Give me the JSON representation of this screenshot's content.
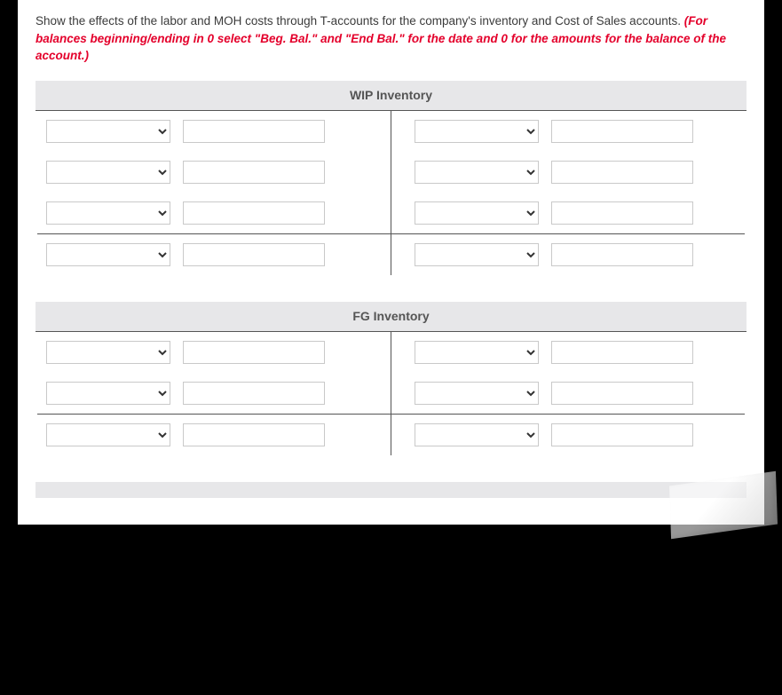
{
  "instructions": {
    "main": "Show the effects of the labor and MOH costs through T-accounts for the company's inventory and Cost of Sales accounts.",
    "note": " (For balances beginning/ending in 0 select \"Beg. Bal.\" and \"End Bal.\" for the date and 0 for the amounts for the balance of the account.)"
  },
  "accounts": {
    "wip": {
      "title": "WIP Inventory",
      "rows": [
        {
          "left": {
            "date": "",
            "amount": ""
          },
          "right": {
            "date": "",
            "amount": ""
          }
        },
        {
          "left": {
            "date": "",
            "amount": ""
          },
          "right": {
            "date": "",
            "amount": ""
          }
        },
        {
          "left": {
            "date": "",
            "amount": ""
          },
          "right": {
            "date": "",
            "amount": ""
          }
        }
      ],
      "balance": {
        "left": {
          "date": "",
          "amount": ""
        },
        "right": {
          "date": "",
          "amount": ""
        }
      }
    },
    "fg": {
      "title": "FG Inventory",
      "rows": [
        {
          "left": {
            "date": "",
            "amount": ""
          },
          "right": {
            "date": "",
            "amount": ""
          }
        },
        {
          "left": {
            "date": "",
            "amount": ""
          },
          "right": {
            "date": "",
            "amount": ""
          }
        }
      ],
      "balance": {
        "left": {
          "date": "",
          "amount": ""
        },
        "right": {
          "date": "",
          "amount": ""
        }
      }
    }
  }
}
